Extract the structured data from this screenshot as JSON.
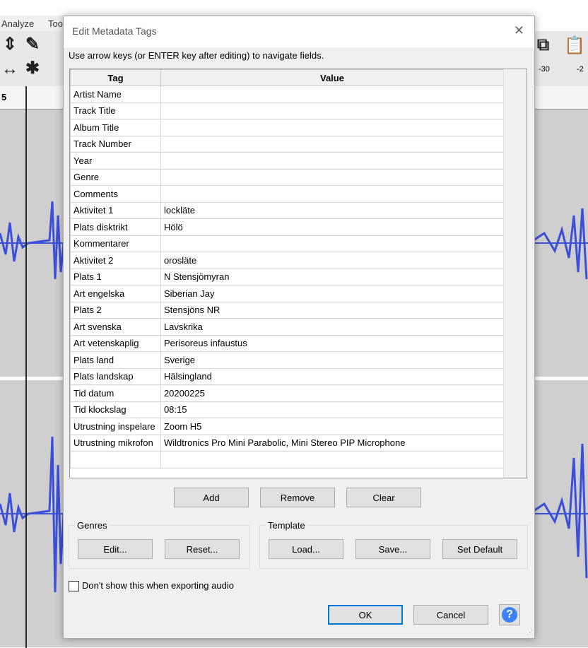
{
  "background": {
    "menu": [
      "Analyze",
      "Too"
    ],
    "ruler_left": "5",
    "ruler_right": [
      "-30",
      "-2"
    ],
    "wave_color": "#3b4fd8"
  },
  "dialog": {
    "title": "Edit Metadata Tags",
    "close_glyph": "✕",
    "hint": "Use arrow keys (or ENTER key after editing) to navigate fields.",
    "columns": [
      "Tag",
      "Value"
    ],
    "rows": [
      {
        "tag": "Artist Name",
        "value": ""
      },
      {
        "tag": "Track Title",
        "value": ""
      },
      {
        "tag": "Album Title",
        "value": ""
      },
      {
        "tag": "Track Number",
        "value": ""
      },
      {
        "tag": "Year",
        "value": ""
      },
      {
        "tag": "Genre",
        "value": ""
      },
      {
        "tag": "Comments",
        "value": ""
      },
      {
        "tag": "Aktivitet 1",
        "value": "lockläte"
      },
      {
        "tag": "Plats disktrikt",
        "value": "Hölö"
      },
      {
        "tag": "Kommentarer",
        "value": ""
      },
      {
        "tag": "Aktivitet 2",
        "value": "orosläte"
      },
      {
        "tag": "Plats 1",
        "value": "N Stensjömyran"
      },
      {
        "tag": "Art engelska",
        "value": "Siberian Jay"
      },
      {
        "tag": "Plats 2",
        "value": "Stensjöns NR"
      },
      {
        "tag": "Art svenska",
        "value": "Lavskrika"
      },
      {
        "tag": "Art vetenskaplig",
        "value": "Perisoreus infaustus"
      },
      {
        "tag": "Plats land",
        "value": "Sverige"
      },
      {
        "tag": "Plats landskap",
        "value": "Hälsingland"
      },
      {
        "tag": "Tid datum",
        "value": "20200225"
      },
      {
        "tag": "Tid klockslag",
        "value": "08:15"
      },
      {
        "tag": "Utrustning inspelare",
        "value": "Zoom H5"
      },
      {
        "tag": "Utrustning mikrofon",
        "value": "Wildtronics Pro Mini Parabolic, Mini Stereo PIP Microphone"
      },
      {
        "tag": "",
        "value": ""
      }
    ],
    "buttons": {
      "add": "Add",
      "remove": "Remove",
      "clear": "Clear"
    },
    "genres": {
      "label": "Genres",
      "edit": "Edit...",
      "reset": "Reset..."
    },
    "template": {
      "label": "Template",
      "load": "Load...",
      "save": "Save...",
      "set_default": "Set Default"
    },
    "checkbox_label": "Don't show this when exporting audio",
    "checkbox_checked": false,
    "ok": "OK",
    "cancel": "Cancel",
    "help_glyph": "?",
    "accent_color": "#0078d7"
  }
}
